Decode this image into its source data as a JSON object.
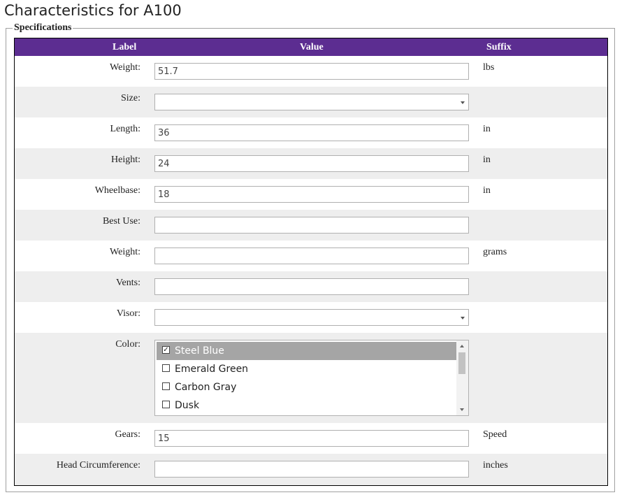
{
  "page": {
    "title": "Characteristics for A100",
    "legend": "Specifications"
  },
  "table": {
    "headers": {
      "label": "Label",
      "value": "Value",
      "suffix": "Suffix"
    },
    "header_color": "#5c2d91",
    "rows": [
      {
        "label": "Weight:",
        "type": "text",
        "value": "51.7",
        "suffix": "lbs"
      },
      {
        "label": "Size:",
        "type": "select",
        "value": "",
        "suffix": ""
      },
      {
        "label": "Length:",
        "type": "text",
        "value": "36",
        "suffix": "in"
      },
      {
        "label": "Height:",
        "type": "text",
        "value": "24",
        "suffix": "in"
      },
      {
        "label": "Wheelbase:",
        "type": "text",
        "value": "18",
        "suffix": "in"
      },
      {
        "label": "Best Use:",
        "type": "text",
        "value": "",
        "suffix": ""
      },
      {
        "label": "Weight:",
        "type": "text",
        "value": "",
        "suffix": "grams"
      },
      {
        "label": "Vents:",
        "type": "text",
        "value": "",
        "suffix": ""
      },
      {
        "label": "Visor:",
        "type": "select",
        "value": "",
        "suffix": ""
      },
      {
        "label": "Color:",
        "type": "checklist",
        "suffix": "",
        "options": [
          {
            "text": "Steel Blue",
            "checked": true
          },
          {
            "text": "Emerald Green",
            "checked": false
          },
          {
            "text": "Carbon Gray",
            "checked": false
          },
          {
            "text": "Dusk",
            "checked": false
          }
        ]
      },
      {
        "label": "Gears:",
        "type": "text",
        "value": "15",
        "suffix": "Speed"
      },
      {
        "label": "Head Circumference:",
        "type": "text",
        "value": "",
        "suffix": "inches"
      }
    ]
  }
}
